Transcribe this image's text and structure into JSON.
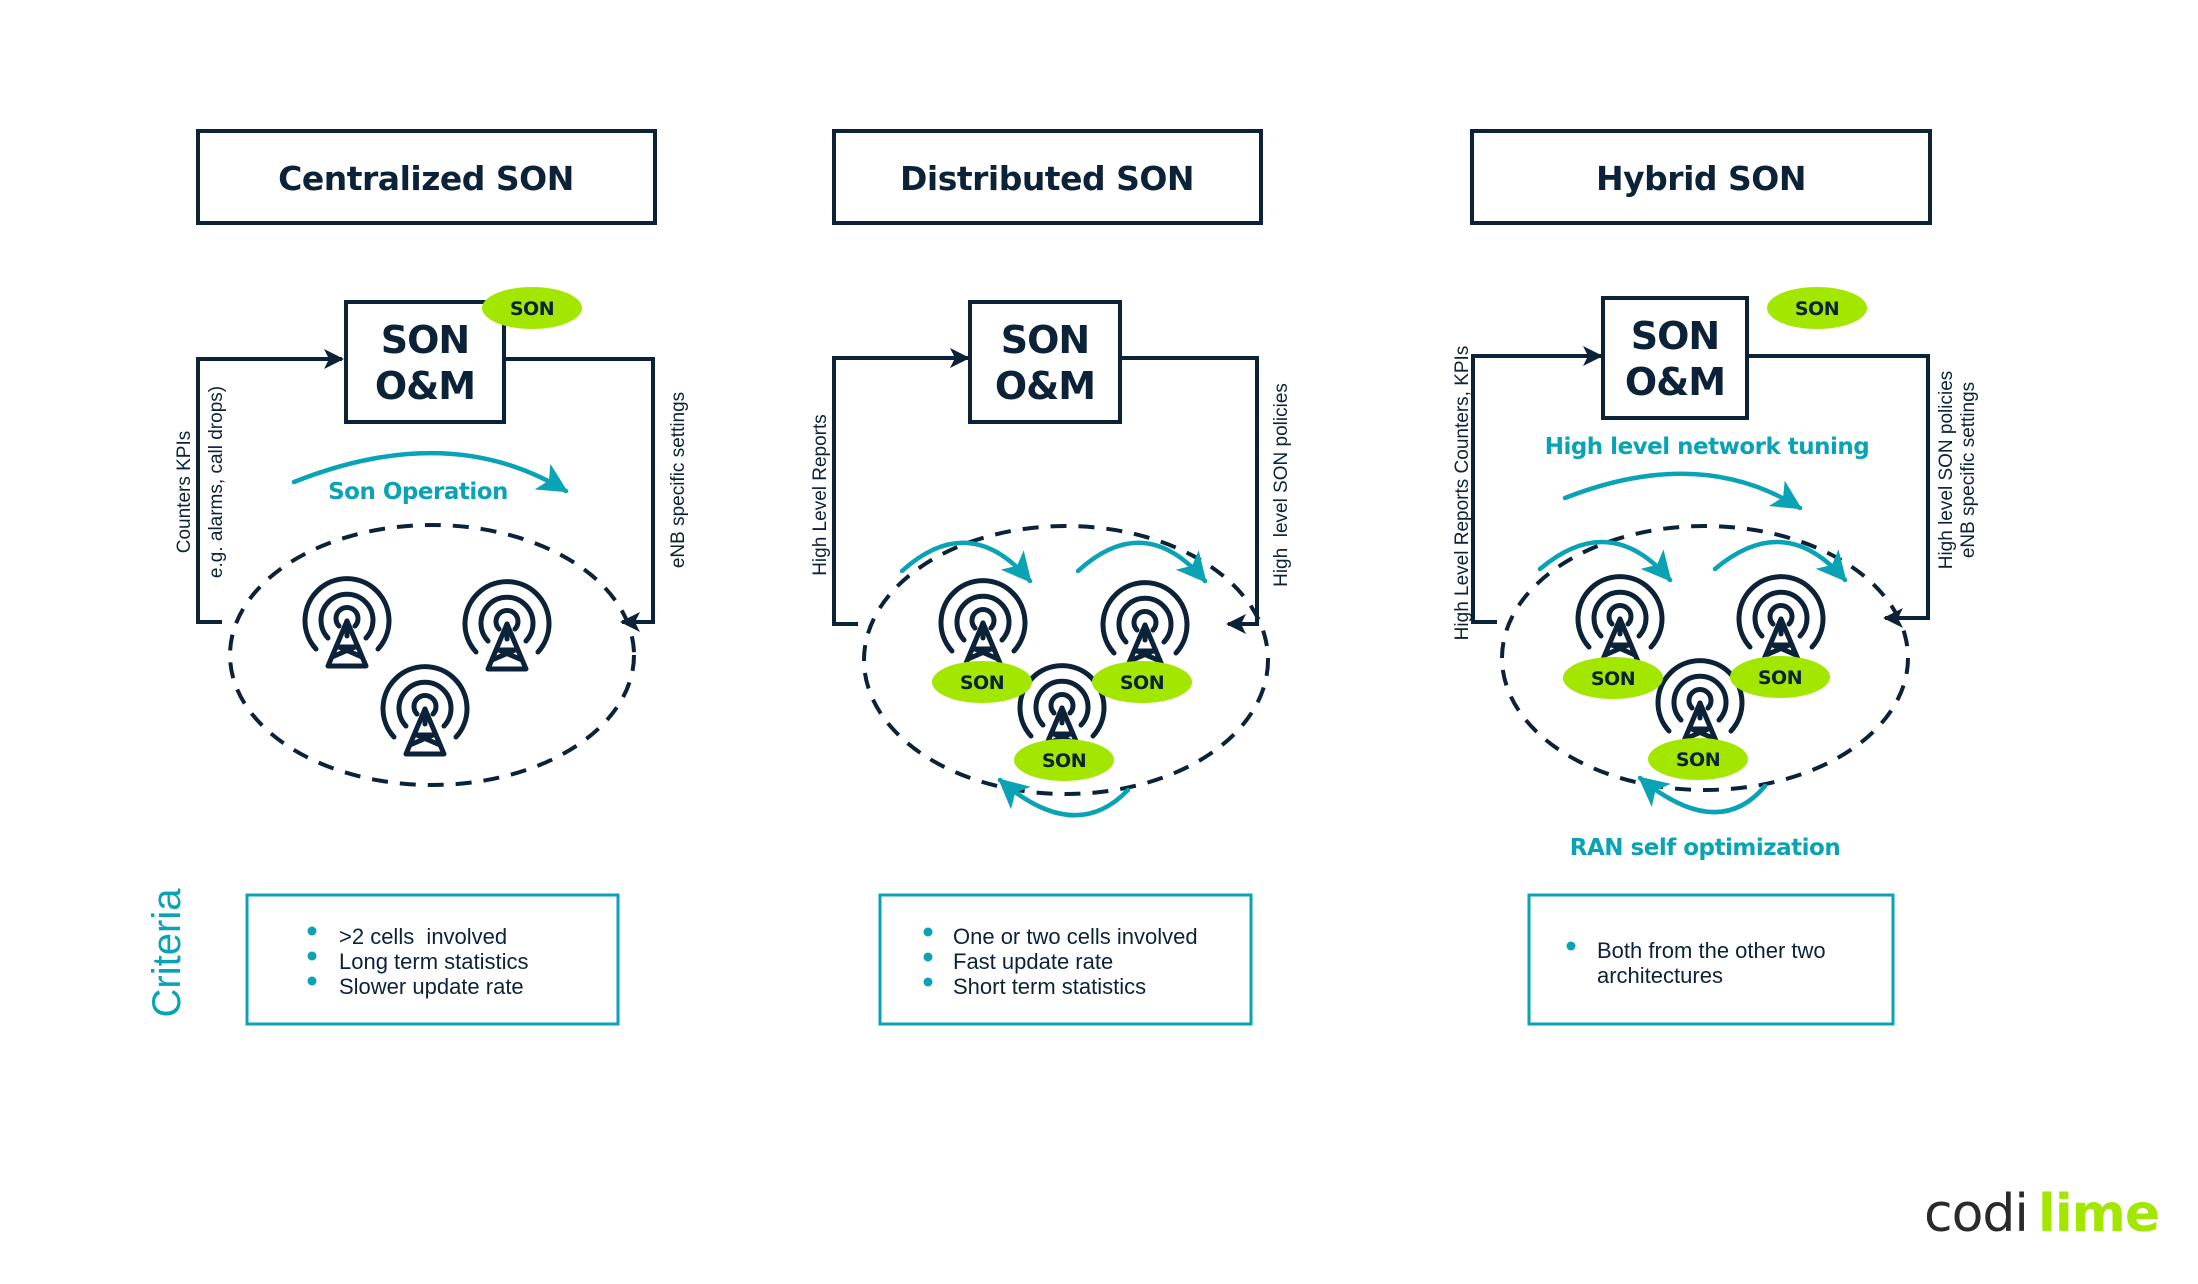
{
  "colors": {
    "navy": "#0c2238",
    "teal": "#0aa3b5",
    "lime": "#a3e600"
  },
  "panels": [
    {
      "id": "centralized",
      "title": "Centralized SON",
      "om_box": {
        "line1": "SON",
        "line2": "O&M",
        "badge": "SON"
      },
      "left_label": [
        "Counters KPIs",
        "e.g. alarms, call drops)"
      ],
      "right_label": [
        "eNB specific settings"
      ],
      "teal_labels": [
        "Son Operation"
      ],
      "towers": [
        {
          "badge": null
        },
        {
          "badge": null
        },
        {
          "badge": null
        }
      ],
      "criteria": [
        ">2 cells  involved",
        "Long term statistics",
        "Slower update rate"
      ]
    },
    {
      "id": "distributed",
      "title": "Distributed SON",
      "om_box": {
        "line1": "SON",
        "line2": "O&M",
        "badge": null
      },
      "left_label": [
        "High Level Reports"
      ],
      "right_label": [
        "High  level SON policies"
      ],
      "teal_labels": [],
      "towers": [
        {
          "badge": "SON"
        },
        {
          "badge": "SON"
        },
        {
          "badge": "SON"
        }
      ],
      "criteria": [
        "One or two cells involved",
        "Fast update rate",
        "Short term statistics"
      ]
    },
    {
      "id": "hybrid",
      "title": "Hybrid SON",
      "om_box": {
        "line1": "SON",
        "line2": "O&M",
        "badge": "SON"
      },
      "left_label": [
        "High Level Reports Counters, KPIs"
      ],
      "right_label": [
        "High level SON policies",
        "eNB specific settings"
      ],
      "teal_labels": [
        "High level network tuning",
        "RAN self optimization"
      ],
      "towers": [
        {
          "badge": "SON"
        },
        {
          "badge": "SON"
        },
        {
          "badge": "SON"
        }
      ],
      "criteria": [
        "Both from the other two",
        "architectures"
      ]
    }
  ],
  "criteria_heading": "Criteria",
  "logo": {
    "part1": "codi",
    "part2": "lime"
  }
}
